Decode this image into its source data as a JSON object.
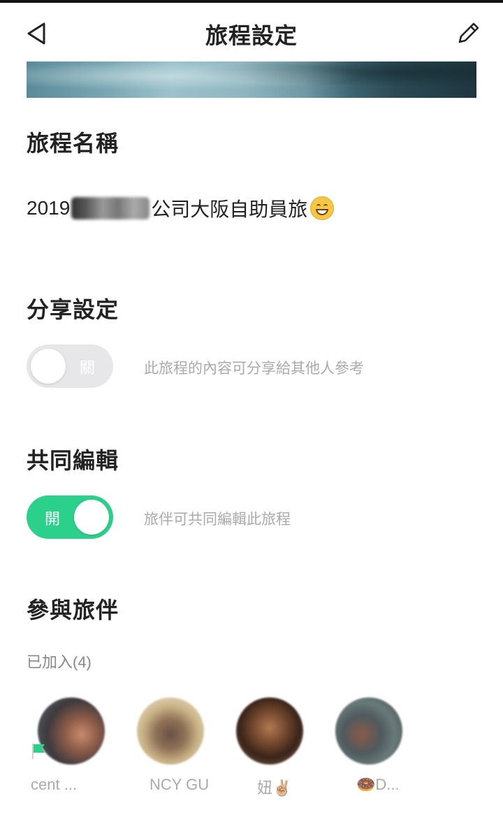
{
  "header": {
    "title": "旅程設定",
    "back_icon": "back-arrow-icon",
    "edit_icon": "pencil-icon"
  },
  "trip_name": {
    "heading": "旅程名稱",
    "prefix": "2019",
    "suffix": "公司大阪自助員旅",
    "emoji": "grinning-face-emoji"
  },
  "share": {
    "heading": "分享設定",
    "toggle_state": "關",
    "enabled": false,
    "description": "此旅程的內容可分享給其他人參考"
  },
  "coedit": {
    "heading": "共同編輯",
    "toggle_state": "開",
    "enabled": true,
    "description": "旅伴可共同編輯此旅程"
  },
  "companions": {
    "heading": "參與旅伴",
    "joined_label": "已加入(4)",
    "members": [
      {
        "name": "cent ...",
        "owner": true
      },
      {
        "name": "NCY GU",
        "owner": false
      },
      {
        "name": "妞✌🏼",
        "owner": false
      },
      {
        "name": "🍩D...",
        "owner": false
      }
    ]
  },
  "colors": {
    "accent_green": "#2bd08b",
    "toggle_off": "#e7e7ea",
    "muted_text": "#aaaaaa"
  }
}
